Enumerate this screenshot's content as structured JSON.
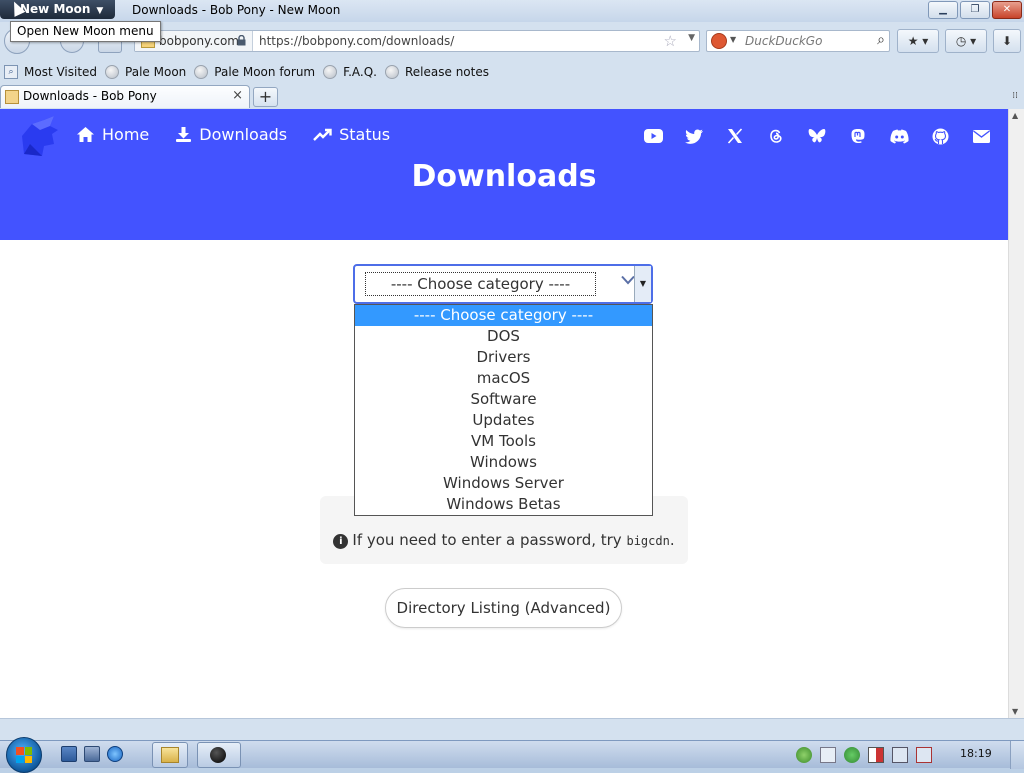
{
  "browser": {
    "app_menu_label": "New Moon",
    "window_title": "Downloads - Bob Pony - New Moon",
    "tooltip": "Open New Moon menu",
    "site_identity": "bobpony.com",
    "url": "https://bobpony.com/downloads/",
    "search_placeholder": "DuckDuckGo",
    "bookmarks": [
      "Most Visited",
      "Pale Moon",
      "Pale Moon forum",
      "F.A.Q.",
      "Release notes"
    ],
    "tab_title": "Downloads - Bob Pony",
    "new_tab_label": "+",
    "tab_close_label": "×"
  },
  "site": {
    "brand_color": "#4353ff",
    "nav": [
      {
        "label": "Home",
        "icon": "home-icon"
      },
      {
        "label": "Downloads",
        "icon": "download-icon"
      },
      {
        "label": "Status",
        "icon": "chart-line-icon"
      }
    ],
    "socials": [
      "youtube-icon",
      "twitter-icon",
      "x-icon",
      "threads-icon",
      "bluesky-icon",
      "mastodon-icon",
      "discord-icon",
      "github-icon",
      "email-icon"
    ],
    "page_title": "Downloads"
  },
  "category_select": {
    "selected": "---- Choose category ----",
    "options": [
      "---- Choose category ----",
      "DOS",
      "Drivers",
      "macOS",
      "Software",
      "Updates",
      "VM Tools",
      "Windows",
      "Windows Server",
      "Windows Betas"
    ]
  },
  "info": {
    "prefix": "If you need to enter a password, try",
    "password": "bigcdn",
    "suffix": "."
  },
  "directory_button": "Directory Listing (Advanced)",
  "taskbar": {
    "clock": "18:19"
  }
}
